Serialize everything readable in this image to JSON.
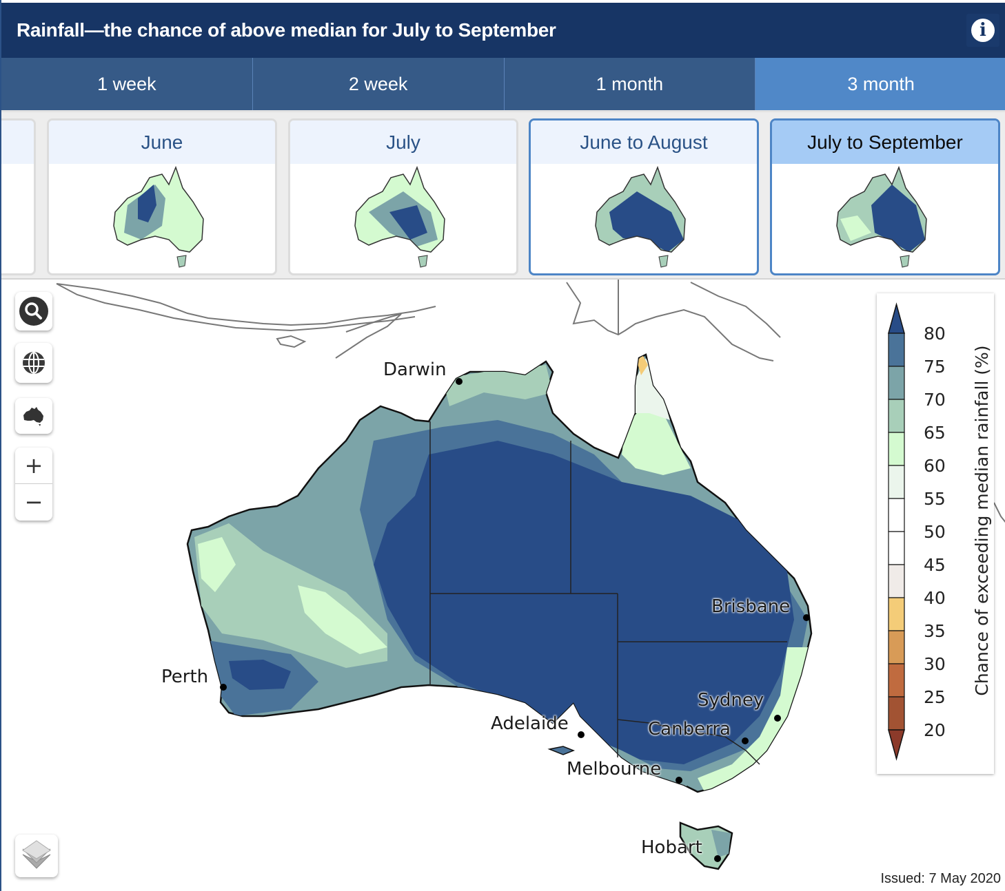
{
  "header": {
    "title": "Rainfall—the chance of above median for July to September",
    "info_icon": "info-icon"
  },
  "tabs": [
    {
      "label": "1 week",
      "active": false
    },
    {
      "label": "2 week",
      "active": false
    },
    {
      "label": "1 month",
      "active": false
    },
    {
      "label": "3 month",
      "active": true
    }
  ],
  "periods": [
    {
      "label": "",
      "state": "partial"
    },
    {
      "label": "June",
      "state": "normal"
    },
    {
      "label": "July",
      "state": "normal"
    },
    {
      "label": "June to August",
      "state": "selected"
    },
    {
      "label": "July to September",
      "state": "current"
    }
  ],
  "map_controls": {
    "search": "search-icon",
    "globe": "globe-icon",
    "australia": "australia-icon",
    "zoom_in": "+",
    "zoom_out": "−",
    "layers": "layers-icon"
  },
  "cities": [
    {
      "name": "Darwin"
    },
    {
      "name": "Brisbane"
    },
    {
      "name": "Perth"
    },
    {
      "name": "Sydney"
    },
    {
      "name": "Adelaide"
    },
    {
      "name": "Canberra"
    },
    {
      "name": "Melbourne"
    },
    {
      "name": "Hobart"
    }
  ],
  "legend": {
    "title": "Chance of exceeding median rainfall (%)",
    "ticks": [
      "80",
      "75",
      "70",
      "65",
      "60",
      "55",
      "50",
      "45",
      "40",
      "35",
      "30",
      "25",
      "20"
    ],
    "bins": [
      {
        "range": ">80",
        "color": "#284c87"
      },
      {
        "range": "75-80",
        "color": "#4a7399"
      },
      {
        "range": "70-75",
        "color": "#7ca4a8"
      },
      {
        "range": "65-70",
        "color": "#a8cfb9"
      },
      {
        "range": "60-65",
        "color": "#d4fad0"
      },
      {
        "range": "55-60",
        "color": "#ebf5ec"
      },
      {
        "range": "50-55",
        "color": "#ffffff"
      },
      {
        "range": "45-50",
        "color": "#ffffff"
      },
      {
        "range": "40-45",
        "color": "#f0ebe8"
      },
      {
        "range": "35-40",
        "color": "#f4cc78"
      },
      {
        "range": "30-35",
        "color": "#d89b57"
      },
      {
        "range": "25-30",
        "color": "#c06b3f"
      },
      {
        "range": "20-25",
        "color": "#a25333"
      },
      {
        "range": "<20",
        "color": "#8c3a2a"
      }
    ]
  },
  "issued": "Issued: 7 May 2020",
  "colors": {
    "header_bg": "#173565",
    "tab_bg": "#365a87",
    "tab_active_bg": "#5088c8",
    "card_label_bg": "#edf3fd",
    "card_current_bg": "#a5cbf5",
    "card_selected_border": "#4d85c6"
  }
}
